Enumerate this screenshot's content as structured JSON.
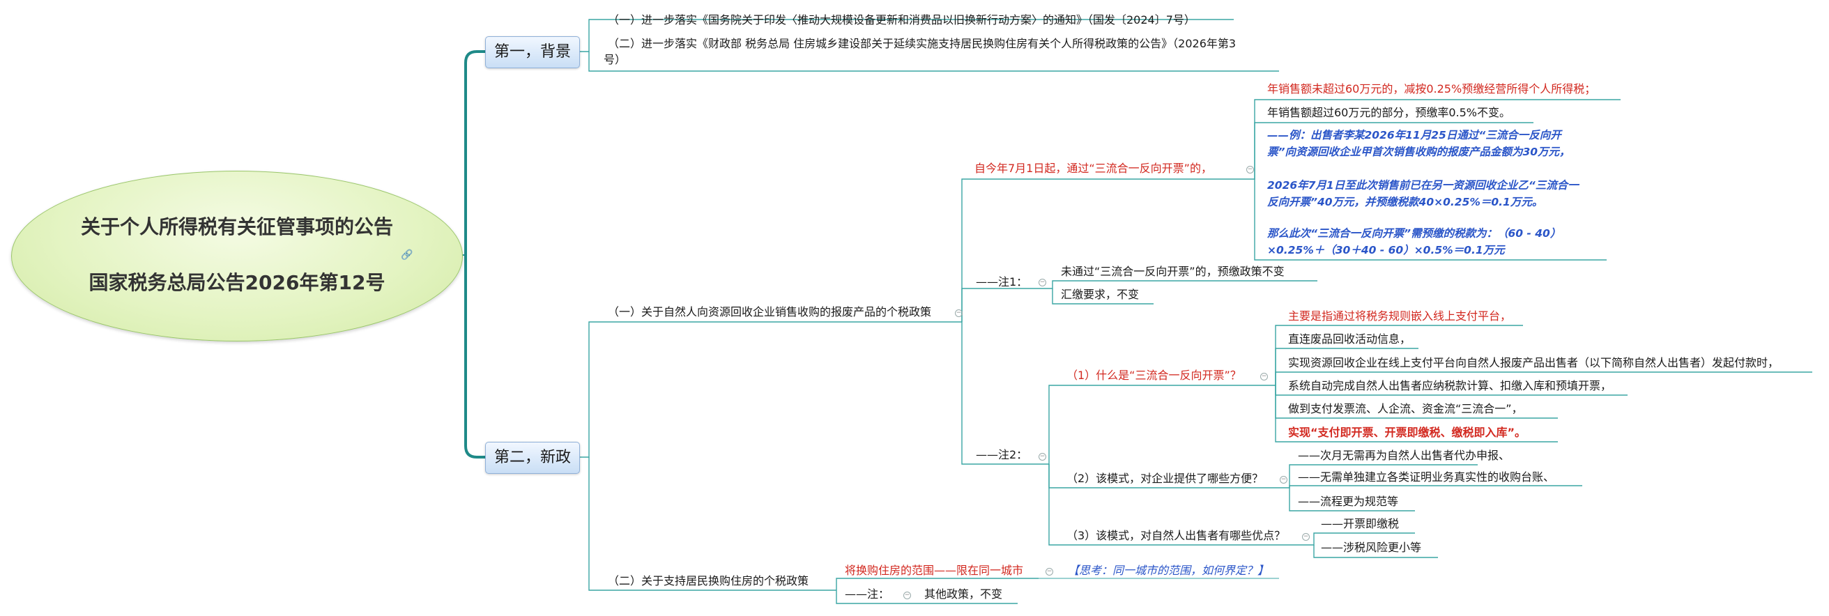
{
  "root": {
    "line1": "关于个人所得税有关征管事项的公告",
    "line2": "国家税务总局公告2026年第12号",
    "link_icon": "link-icon"
  },
  "background": {
    "label": "第一，背景",
    "items": [
      "（一）进一步落实《国务院关于印发〈推动大规模设备更新和消费品以旧换新行动方案〉的通知》（国发〔2024〕7号）",
      "（二）进一步落实《财政部 税务总局 住房城乡建设部关于延续实施支持居民换购住房有关个人所得税政策的公告》（2026年第3",
      "号）"
    ]
  },
  "new_policy": {
    "label": "第二，新政",
    "section1": {
      "label": "（一）关于自然人向资源回收企业销售收购的报废产品的个税政策",
      "from_july": "自今年7月1日起，通过“三流合一反向开票”的，",
      "from_july_children": [
        "年销售额未超过60万元的，减按0.25%预缴经营所得个人所得税；",
        "年销售额超过60万元的部分，预缴率0.5%不变。"
      ],
      "example": [
        "——例：出售者李某2026年11月25日通过“三流合一反向开",
        "票”向资源回收企业甲首次销售收购的报废产品金额为30万元，",
        "2026年7月1日至此次销售前已在另一资源回收企业乙“三流合一",
        "反向开票”40万元，并预缴税款40×0.25%＝0.1万元。",
        "那么此次“三流合一反向开票”需预缴的税款为：（60 - 40）",
        "×0.25%＋（30＋40 - 60）×0.5%＝0.1万元"
      ],
      "note1": {
        "label": "——注1：",
        "items": [
          "未通过“三流合一反向开票”的，预缴政策不变",
          "汇缴要求，不变"
        ]
      },
      "note2": {
        "label": "——注2：",
        "q1": {
          "label": "（1）什么是“三流合一反向开票”？",
          "items": [
            "主要是指通过将税务规则嵌入线上支付平台，",
            "直连废品回收活动信息，",
            "实现资源回收企业在线上支付平台向自然人报废产品出售者（以下简称自然人出售者）发起付款时，",
            "系统自动完成自然人出售者应纳税款计算、扣缴入库和预填开票，",
            "做到支付发票流、人企流、资金流“三流合一”，",
            "实现“支付即开票、开票即缴税、缴税即入库”。"
          ]
        },
        "q2": {
          "label": "（2）该模式，对企业提供了哪些方便？",
          "items": [
            "——次月无需再为自然人出售者代办申报、",
            "——无需单独建立各类证明业务真实性的收购台账、",
            "——流程更为规范等"
          ]
        },
        "q3": {
          "label": "（3）该模式，对自然人出售者有哪些优点？",
          "items": [
            "——开票即缴税",
            "——涉税风险更小等"
          ]
        }
      }
    },
    "section2": {
      "label": "（二）关于支持居民换购住房的个税政策",
      "scope": "将换购住房的范围——限在同一城市",
      "think": "【思考：同一城市的范围，如何界定？】",
      "note_label": "——注：",
      "note_text": "其他政策，不变"
    }
  },
  "colors": {
    "root_fill": "#e4f4c3",
    "branch_fill": "#c9def5",
    "connector": "#2a9d9b",
    "red": "#d2281f",
    "blue": "#2a55c8"
  }
}
